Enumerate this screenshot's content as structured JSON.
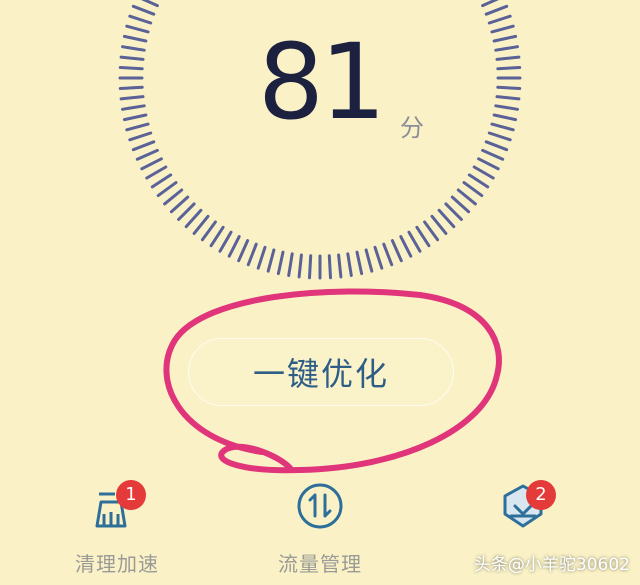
{
  "score": {
    "value": "81",
    "unit": "分",
    "tick_color": "#5a6297"
  },
  "optimize_button": {
    "label": "一键优化"
  },
  "nav": [
    {
      "label": "清理加速",
      "icon": "broom-clean-icon",
      "badge": "1"
    },
    {
      "label": "流量管理",
      "icon": "data-traffic-icon",
      "badge": ""
    },
    {
      "label": "",
      "icon": "shield-download-icon",
      "badge": "2"
    }
  ],
  "watermark": "头条@小羊驼30602",
  "colors": {
    "background": "#faf2c6",
    "accent": "#2e5d86",
    "annotation": "#e0357a",
    "badge": "#e53a3a"
  }
}
